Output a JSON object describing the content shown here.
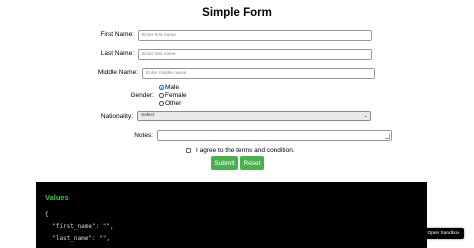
{
  "form": {
    "title": "Simple Form",
    "first_name": {
      "label": "First Name:",
      "placeholder": "Enter first name"
    },
    "last_name": {
      "label": "Last Name:",
      "placeholder": "Enter last name"
    },
    "middle_name": {
      "label": "Middle Name:",
      "placeholder": "Enter middle name"
    },
    "gender": {
      "label": "Gender:",
      "options": [
        {
          "label": "Male",
          "selected": true
        },
        {
          "label": "Female",
          "selected": false
        },
        {
          "label": "Other",
          "selected": false
        }
      ]
    },
    "nationality": {
      "label": "Nationality:",
      "value": "Select"
    },
    "notes": {
      "label": "Notes:"
    },
    "terms": {
      "label": "I agree to the terms and condition.",
      "checked": false
    },
    "submit_label": "Submit",
    "reset_label": "Reset"
  },
  "values_panel": {
    "title": "Values",
    "lines": [
      "{",
      "  \"first_name\": \"\",",
      "  \"last_name\": \"\","
    ]
  },
  "sandbox_button": {
    "label": "Open Sandbox"
  },
  "colors": {
    "button_green": "#4caf50",
    "panel_background": "#000000",
    "values_title": "#44c23c"
  }
}
